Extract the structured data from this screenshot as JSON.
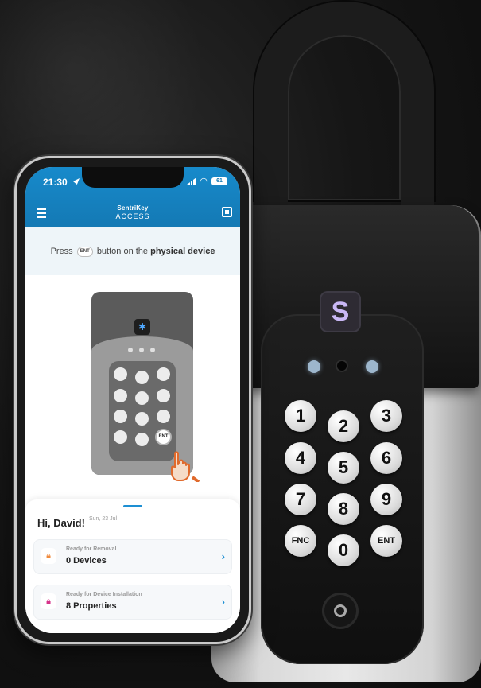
{
  "status_bar": {
    "time": "21:30",
    "battery": "61"
  },
  "app": {
    "brand_name": "SentriKey",
    "brand_sub": "ACCESS"
  },
  "prompt": {
    "before": "Press",
    "key_badge": "ENT",
    "middle": "button on the",
    "bold": "physical device"
  },
  "illustration": {
    "ent_label": "ENT",
    "bluetooth_glyph": "✱"
  },
  "dashboard": {
    "greeting": "Hi, David!",
    "date": "Sun, 23 Jul",
    "cards": [
      {
        "label": "Ready for Removal",
        "value": "0 Devices",
        "icon": "lock-icon",
        "icon_color": "#f08a3c"
      },
      {
        "label": "Ready for Device Installation",
        "value": "8 Properties",
        "icon": "lock-icon",
        "icon_color": "#d6338a"
      }
    ]
  },
  "lockbox": {
    "logo_glyph": "S",
    "keys": [
      "1",
      "2",
      "3",
      "4",
      "5",
      "6",
      "7",
      "8",
      "9",
      "FNC",
      "0",
      "ENT"
    ]
  },
  "colors": {
    "app_blue": "#1479b4",
    "accent_blue": "#1d8fd3",
    "lockbox_logo": "#c9b7f5"
  }
}
